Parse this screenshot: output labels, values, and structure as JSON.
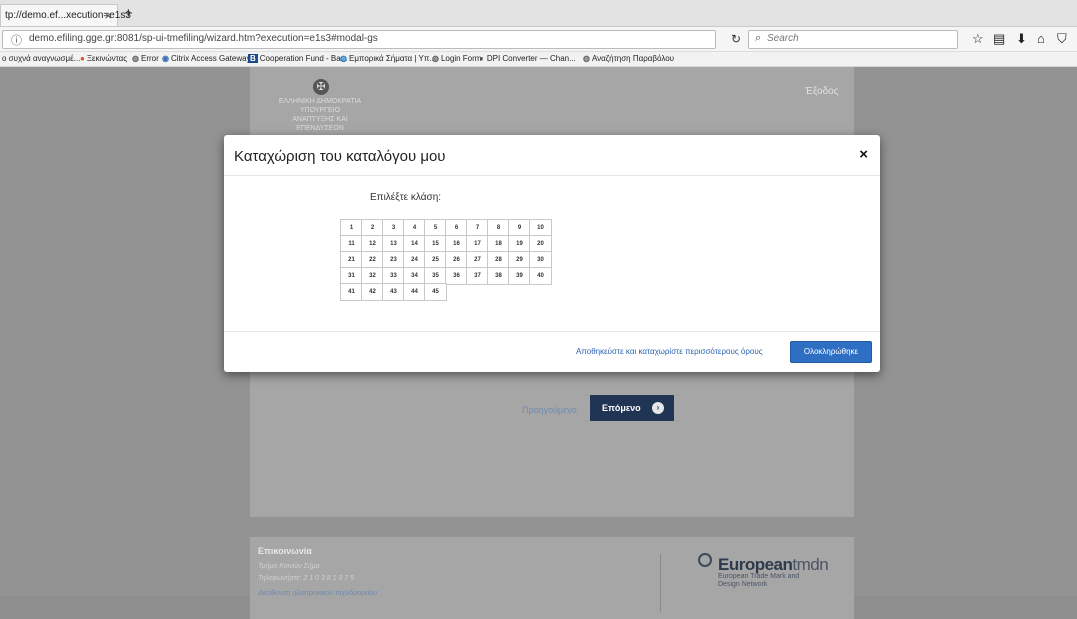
{
  "browser": {
    "tab_title": "tp://demo.ef...xecution=e1s3",
    "tab_close": "×",
    "new_tab": "+",
    "url": "demo.efiling.gge.gr:8081/sp-ui-tmefiling/wizard.htm?execution=e1s3#modal-gs",
    "search_placeholder": "Search",
    "bookmarks": [
      "ο συχνά αναγνωσμέ...",
      "Ξεκινώντας",
      "Error",
      "Citrix Access Gateway",
      "Cooperation Fund - Ba...",
      "Εμπορικά Σήματα | Υπ...",
      "Login Form",
      "DPI Converter — Chan...",
      "Αναζήτηση Παραβόλου"
    ]
  },
  "page": {
    "ministry_lines": [
      "ΕΛΛΗΝΙΚΗ ΔΗΜΟΚΡΑΤΙΑ",
      "ΥΠΟΥΡΓΕΙΟ",
      "ΑΝΑΠΤΥΞΗΣ ΚΑΙ ΕΠΕΝΔΥΣΕΩΝ"
    ],
    "logout": "Έξοδος",
    "prev_link": "Προηγούμενο",
    "next_button": "Επόμενο",
    "footer": {
      "title": "Επικοινωνία",
      "lines": [
        "Τμήμα Κοινών Σήμα",
        "Τηλεφωνήστε: 2 1 0 3 8 1 3 7 5"
      ],
      "link": "Διεύθυνση ηλεκτρονικού ταχυδρομείου",
      "logo_main": "European",
      "logo_tail": "tmdn",
      "logo_sub": "European Trade Mark and Design Network"
    }
  },
  "modal": {
    "title": "Καταχώριση του καταλόγου μου",
    "close": "×",
    "class_label": "Επιλέξτε κλάση:",
    "classes": [
      "1",
      "2",
      "3",
      "4",
      "5",
      "6",
      "7",
      "8",
      "9",
      "10",
      "11",
      "12",
      "13",
      "14",
      "15",
      "16",
      "17",
      "18",
      "19",
      "20",
      "21",
      "22",
      "23",
      "24",
      "25",
      "26",
      "27",
      "28",
      "29",
      "30",
      "31",
      "32",
      "33",
      "34",
      "35",
      "36",
      "37",
      "38",
      "39",
      "40",
      "41",
      "42",
      "43",
      "44",
      "45"
    ],
    "save_more": "Αποθηκεύστε και καταχωρίστε περισσότερους όρους",
    "complete_button": "Ολοκληρώθηκε"
  }
}
